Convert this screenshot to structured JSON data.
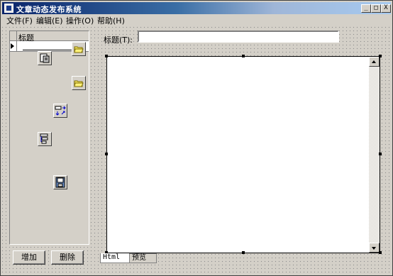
{
  "window": {
    "title": "文章动态发布系统",
    "buttons": {
      "minimize": "_",
      "maximize": "□",
      "close": "X"
    }
  },
  "menu": [
    {
      "label": "文件(F)"
    },
    {
      "label": "编辑(E)"
    },
    {
      "label": "操作(O)"
    },
    {
      "label": "帮助(H)"
    }
  ],
  "list": {
    "column_header": "标题"
  },
  "toolbar_icons": [
    "open-folder-icon",
    "properties-icon",
    "open-folder-icon",
    "layout-arrange-icon",
    "tree-view-icon",
    "save-icon"
  ],
  "buttons": {
    "add": "增加",
    "delete": "删除"
  },
  "form": {
    "title_label": "标题(T):",
    "title_value": ""
  },
  "tabs": [
    {
      "label": "Html"
    },
    {
      "label": "预览"
    }
  ]
}
